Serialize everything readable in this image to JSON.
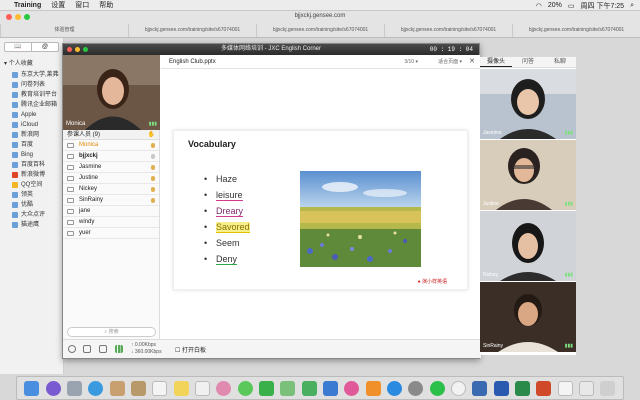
{
  "menubar": {
    "app": "Training",
    "items": [
      "设置",
      "窗口",
      "帮助"
    ],
    "clock": "周四 下午7:25",
    "battery": "20%"
  },
  "browser": {
    "url": "bjjxckj.gensee.com",
    "tabs": [
      "体验管理",
      "bjjxckj.gensee.com/training/site/s67074001",
      "bjjxckj.gensee.com/training/site/s67074001",
      "bjjxckj.gensee.com/training/site/s67074001",
      "bjjxckj.gensee.com/training/site/s67074001"
    ]
  },
  "sidebar": {
    "segments": [
      "📖",
      "@"
    ],
    "group": "个人收藏",
    "items": [
      "东京大学,莱弗",
      "问卷列表",
      "教育培训平台",
      "腾讯企业邮箱",
      "Apple",
      "iCloud",
      "新浪网",
      "百度",
      "Bing",
      "百度百科",
      "新浪微博",
      "QQ空间",
      "领英",
      "优酷",
      "大众点评",
      "猫途鹰"
    ]
  },
  "app": {
    "title": "多媒体网络培训 - JXC English Corner",
    "timer": "00 : 19 : 04"
  },
  "webcam": {
    "name": "Monica"
  },
  "people": {
    "header": "参课人员 (9)",
    "rows": [
      "Monica",
      "bjjxckj",
      "Jasmine",
      "Justine",
      "Nickey",
      "SinRainy",
      "jane",
      "windy",
      "yuer"
    ],
    "search_placeholder": "搜索"
  },
  "bottom": {
    "speed_up": "↑ 0.00Kbps",
    "speed_down": "↓ 360.00Kbps",
    "toggle": "打开白板"
  },
  "doc": {
    "filename": "English Club.pptx",
    "page": "3/10",
    "mode": "适合页面"
  },
  "slide": {
    "title": "Vocabulary",
    "words": [
      "Haze",
      "leisure",
      "Dreary",
      "Savored",
      "Seem",
      "Deny"
    ],
    "logo": "演小样英语"
  },
  "cams": {
    "tabs": [
      "摄像头",
      "问答",
      "私聊"
    ],
    "people": [
      "Jasmine",
      "Justine",
      "Nickey",
      "SinRainy"
    ]
  },
  "colors": {
    "accent": "#e08a00",
    "titlebar": "#333333"
  }
}
